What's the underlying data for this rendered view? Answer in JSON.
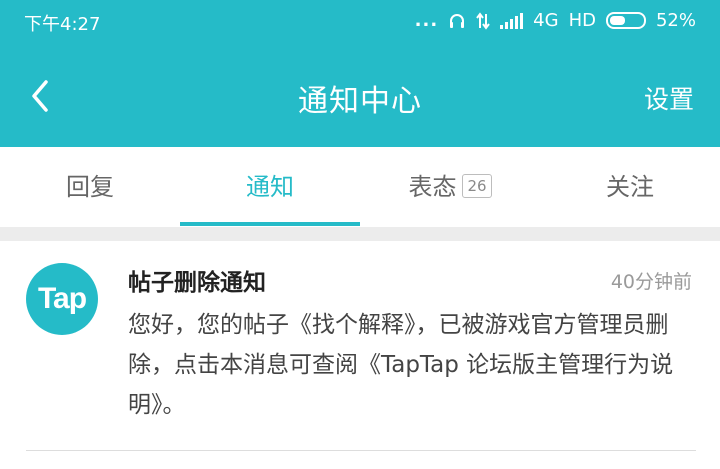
{
  "status_bar": {
    "time": "下午4:27",
    "dots": "...",
    "network": "4G",
    "hd": "HD",
    "battery": "52%"
  },
  "nav": {
    "back_icon": "chevron-left-icon",
    "title": "通知中心",
    "settings": "设置"
  },
  "tabs": [
    {
      "label": "回复"
    },
    {
      "label": "通知"
    },
    {
      "label": "表态",
      "badge": "26"
    },
    {
      "label": "关注"
    }
  ],
  "active_tab": 1,
  "message": {
    "avatar_text": "Tap",
    "title": "帖子删除通知",
    "time": "40分钟前",
    "body": "您好，您的帖子《找个解释》，已被游戏官方管理员删除，点击本消息可查阅《TapTap 论坛版主管理行为说明》。"
  },
  "colors": {
    "accent": "#25bbc8",
    "background": "#ececec",
    "text": "#444444"
  }
}
